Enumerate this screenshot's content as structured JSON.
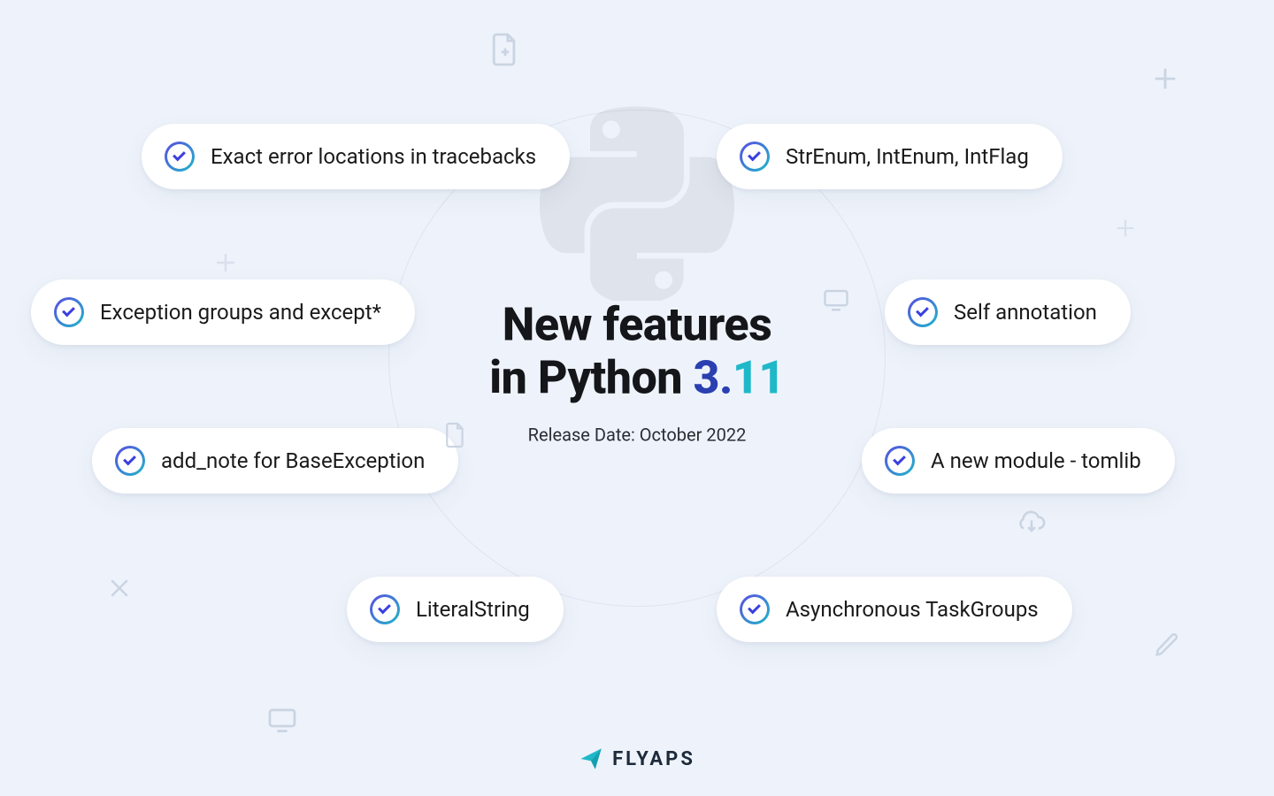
{
  "heading": {
    "line1": "New features",
    "line2_prefix": "in Python ",
    "version_major": "3.",
    "version_minor": "11",
    "subtitle": "Release Date: October 2022"
  },
  "features": {
    "left": [
      "Exact error locations in tracebacks",
      "Exception groups and except*",
      "add_note for BaseException",
      "LiteralString"
    ],
    "right": [
      "StrEnum, IntEnum, IntFlag",
      "Self annotation",
      "A new module - tomlib",
      "Asynchronous TaskGroups"
    ]
  },
  "brand": {
    "name": "FLYAPS"
  }
}
